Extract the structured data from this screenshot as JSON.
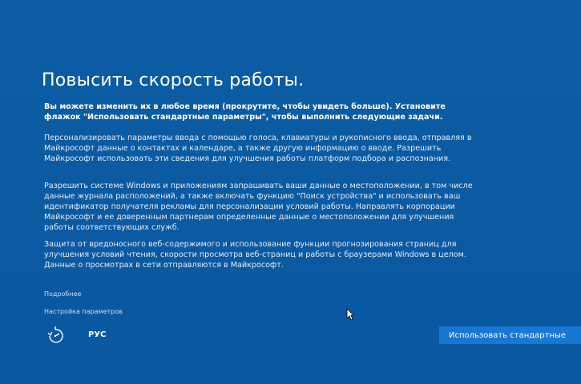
{
  "page": {
    "title": "Повысить скорость работы.",
    "intro": "Вы можете изменить их в любое время (прокрутите, чтобы увидеть больше). Установите флажок \"Использовать стандартные параметры\", чтобы выполнить следующие задачи.",
    "paragraphs": [
      "Персонализировать параметры ввода с помощью голоса, клавиатуры и рукописного ввода, отправляя в Майкрософт данные о контактах и календаре, а также другую информацию о вводе. Разрешить Майкрософт использовать эти сведения для улучшения работы платформ подбора и распознания.",
      "Разрешить системе Windows и приложениям запрашивать ваши данные о местоположении, в том числе данные журнала расположений, а также включать функцию \"Поиск устройства\" и использовать ваш идентификатор получателя рекламы для персонализации условий работы. Направлять корпорации Майкрософт и ее доверенным партнерам определенные данные о местоположении для улучшения работы соответствующих служб.",
      "Защита от вредоносного веб-содержимого и использование функции прогнозирования страниц для улучшения условий чтения, скорости просмотра веб-страниц и работы с браузерами Windows в целом. Данные о просмотрах в сети отправляются в Майкрософт."
    ]
  },
  "links": {
    "more": "Подробнее",
    "settings": "Настройка параметров"
  },
  "footer": {
    "language": "РУС",
    "ease_icon": "ease-of-access-icon",
    "default_button": "Использовать стандартные"
  },
  "colors": {
    "background": "#0b5aa0",
    "button": "#1777d2",
    "text": "#ffffff"
  }
}
